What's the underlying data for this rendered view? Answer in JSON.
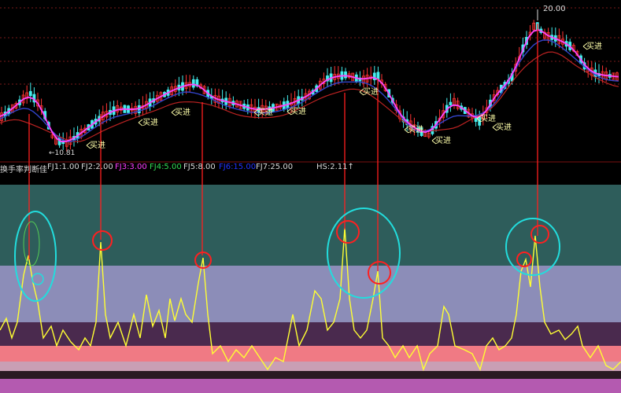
{
  "header": {
    "price_label": "20.00",
    "low_label": "←10.81",
    "indicator_name": "换手率判断佳",
    "hs_label": "HS:2.11↑"
  },
  "indicator_legend": [
    {
      "label": "FJ1:1.00",
      "color": "#d8d8d8"
    },
    {
      "label": "FJ2:2.00",
      "color": "#d8d8d8"
    },
    {
      "label": "FJ3:3.00",
      "color": "#ff3cff"
    },
    {
      "label": "FJ4:5.00",
      "color": "#33dd55"
    },
    {
      "label": "FJ5:8.00",
      "color": "#d8d8d8"
    },
    {
      "label": "FJ6:15.00",
      "color": "#2233ff"
    },
    {
      "label": "FJ7:25.00",
      "color": "#d8d8d8"
    }
  ],
  "buy_signals": [
    "买进",
    "买进",
    "买进",
    "买进",
    "买进",
    "买进",
    "买进",
    "买进",
    "买进",
    "买进",
    "买进"
  ],
  "colors": {
    "background": "#000000",
    "band_teal": "#2e5d5b",
    "band_lavender": "#8c8db8",
    "band_purple": "#4a2a4e",
    "band_salmon": "#f07a84",
    "band_pink": "#c99fb4",
    "band_magenta": "#b45ab0",
    "turnover_line": "#ffff33",
    "ma_short": "#ff44ff",
    "ma_long": "#3344cc",
    "ma_slow": "#bb2222",
    "candle_up": "#ff3333",
    "candle_down": "#44eeee",
    "marker_red": "#ff2020",
    "marker_cyan": "#22dddd",
    "buy_text": "#ffffaa"
  }
}
